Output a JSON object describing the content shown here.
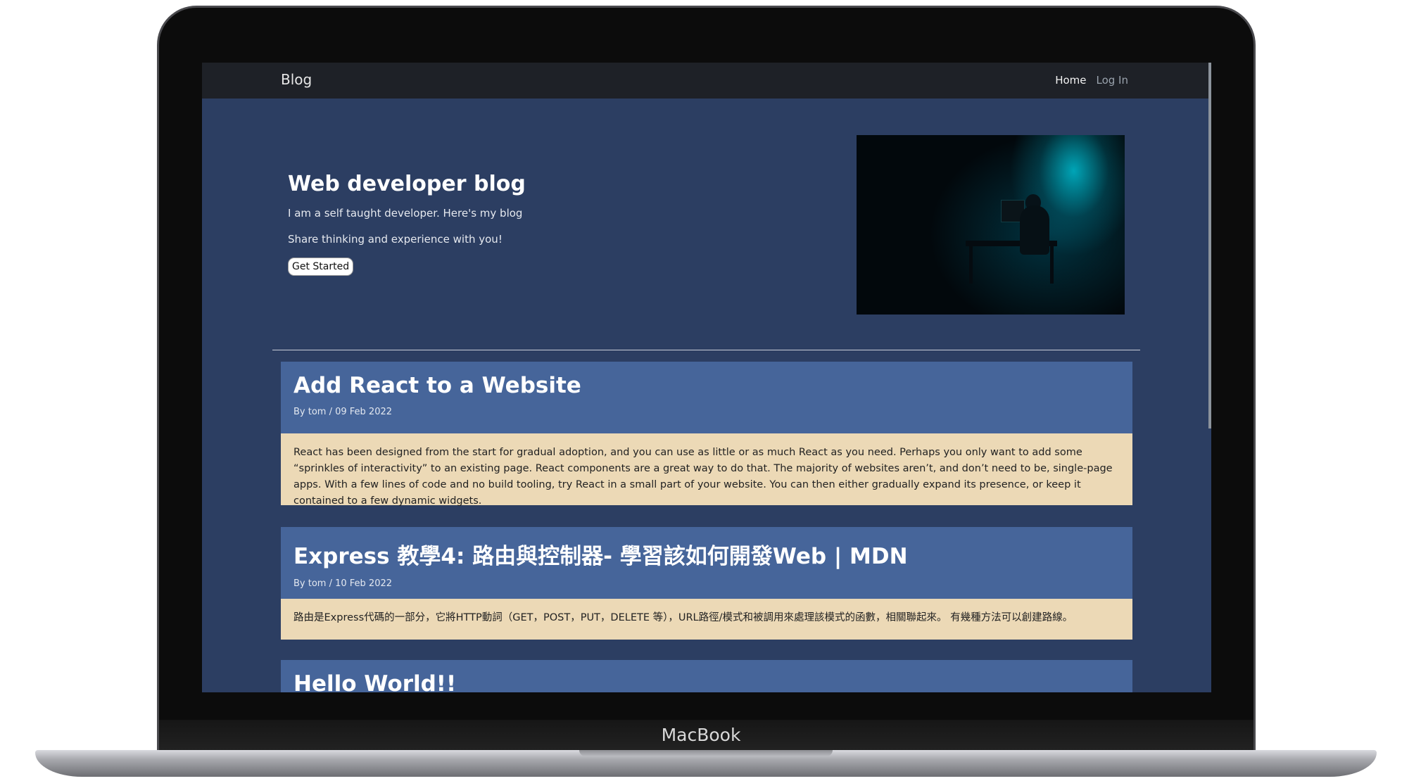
{
  "device": {
    "label": "MacBook"
  },
  "nav": {
    "brand": "Blog",
    "links": [
      "Home",
      "Log In"
    ]
  },
  "hero": {
    "title": "Web developer blog",
    "line1": "I am a self taught developer. Here's my blog",
    "line2": "Share thinking and experience with you!",
    "cta": "Get Started"
  },
  "posts": [
    {
      "title": "Add React to a Website",
      "meta": "By tom / 09 Feb 2022",
      "excerpt": "React has been designed from the start for gradual adoption, and you can use as little or as much React as you need. Perhaps you only want to add some “sprinkles of interactivity” to an existing page. React components are a great way to do that. The majority of websites aren’t, and don’t need to be, single-page apps. With a few lines of code and no build tooling, try React in a small part of your website. You can then either gradually expand its presence, or keep it contained to a few dynamic widgets."
    },
    {
      "title": "Express 教學4: 路由與控制器- 學習該如何開發Web | MDN",
      "meta": "By tom / 10 Feb 2022",
      "excerpt": "路由是Express代碼的一部分，它將HTTP動詞（GET，POST，PUT，DELETE 等），URL路徑/模式和被調用來處理該模式的函數，相關聯起來。 有幾種方法可以創建路線。"
    },
    {
      "title": "Hello World!!"
    }
  ]
}
